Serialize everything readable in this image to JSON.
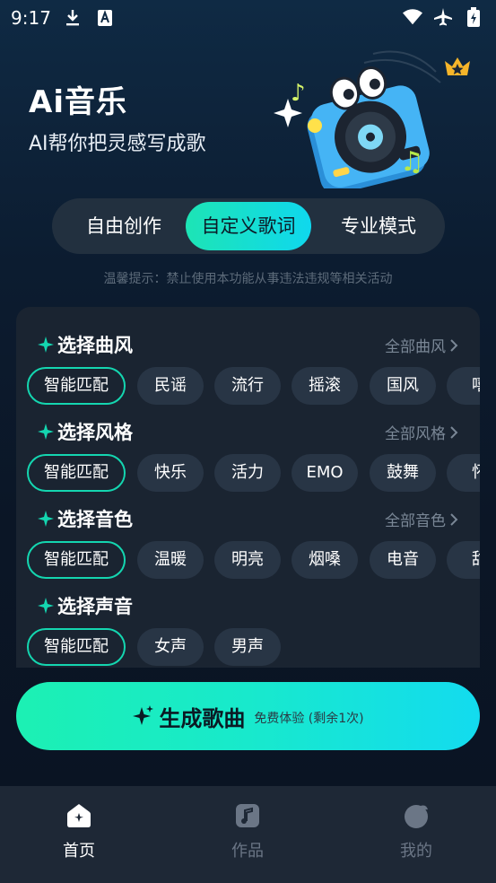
{
  "status_bar": {
    "time": "9:17"
  },
  "hero": {
    "title": "Ai音乐",
    "subtitle": "AI帮你把灵感写成歌"
  },
  "tabs": [
    {
      "label": "自由创作",
      "active": false
    },
    {
      "label": "自定义歌词",
      "active": true
    },
    {
      "label": "专业模式",
      "active": false
    }
  ],
  "notice": "温馨提示：禁止使用本功能从事违法违规等相关活动",
  "sections": [
    {
      "title": "选择曲风",
      "more": "全部曲风",
      "chips": [
        "智能匹配",
        "民谣",
        "流行",
        "摇滚",
        "国风",
        "嘻"
      ]
    },
    {
      "title": "选择风格",
      "more": "全部风格",
      "chips": [
        "智能匹配",
        "快乐",
        "活力",
        "EMO",
        "鼓舞",
        "怀"
      ]
    },
    {
      "title": "选择音色",
      "more": "全部音色",
      "chips": [
        "智能匹配",
        "温暖",
        "明亮",
        "烟嗓",
        "电音",
        "甜"
      ]
    },
    {
      "title": "选择声音",
      "more": "",
      "chips": [
        "智能匹配",
        "女声",
        "男声"
      ]
    }
  ],
  "generate": {
    "label": "生成歌曲",
    "sub": "免费体验 (剩余1次)"
  },
  "nav": [
    {
      "label": "首页",
      "icon": "home-icon",
      "active": true
    },
    {
      "label": "作品",
      "icon": "music-note-icon",
      "active": false
    },
    {
      "label": "我的",
      "icon": "profile-icon",
      "active": false
    }
  ],
  "colors": {
    "accent_start": "#1cf0b3",
    "accent_end": "#13dbef",
    "chip_bg": "#283545",
    "panel_bg": "#1a2431"
  }
}
